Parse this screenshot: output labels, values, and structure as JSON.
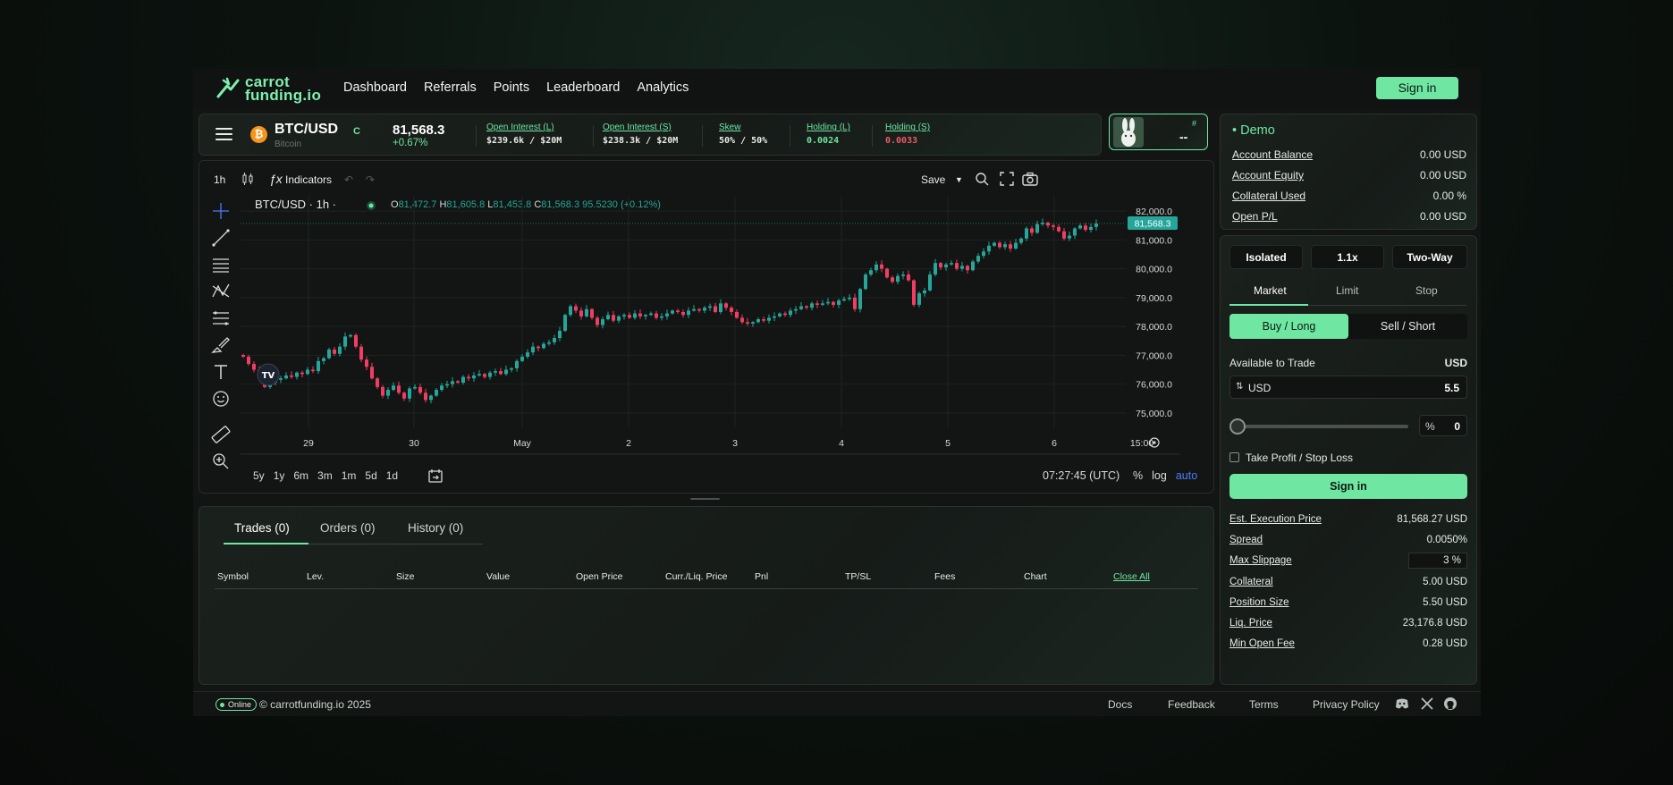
{
  "brand": {
    "line1": "carrot",
    "line2": "funding.io"
  },
  "nav": {
    "items": [
      "Dashboard",
      "Referrals",
      "Points",
      "Leaderboard",
      "Analytics"
    ],
    "signin": "Sign in"
  },
  "ticker": {
    "coin_symbol": "₿",
    "pair": "BTC/USD",
    "badge": "C",
    "name": "Bitcoin",
    "price": "81,568.3",
    "change": "+0.67%",
    "stats": [
      {
        "label": "Open Interest (L)",
        "value": "$239.6k / $20M"
      },
      {
        "label": "Open Interest (S)",
        "value": "$238.3k / $20M"
      },
      {
        "label": "Skew",
        "value": "50% / 50%"
      },
      {
        "label": "Holding (L)",
        "value": "0.0024"
      },
      {
        "label": "Holding (S)",
        "value": "0.0033"
      }
    ]
  },
  "avatar": {
    "hash": "#",
    "value": "--"
  },
  "chart_toolbar": {
    "interval": "1h",
    "indicators": "Indicators",
    "save": "Save"
  },
  "chart_header": {
    "title": "BTC/USD · 1h ·",
    "o_label": "O",
    "o": "81,472.7",
    "h_label": "H",
    "h": "81,605.8",
    "l_label": "L",
    "l": "81,453.8",
    "c_label": "C",
    "c": "81,568.3",
    "chg": "95.5230 (+0.12%)"
  },
  "chart_data": {
    "type": "candlestick",
    "title": "BTC/USD · 1h",
    "x_ticks": [
      "29",
      "30",
      "May",
      "2",
      "3",
      "4",
      "5",
      "6",
      "15:00"
    ],
    "y_ticks": [
      "82,000.0",
      "81,000.0",
      "80,000.0",
      "79,000.0",
      "78,000.0",
      "77,000.0",
      "76,000.0",
      "75,000.0"
    ],
    "ylim": [
      74500,
      82500
    ],
    "last_price_label": "81,568.3",
    "closes": [
      76950,
      76700,
      76500,
      76300,
      75900,
      76050,
      76150,
      76200,
      76300,
      76250,
      76400,
      76350,
      76500,
      76450,
      76800,
      76900,
      77200,
      77050,
      77300,
      77650,
      77700,
      77300,
      76850,
      76600,
      76200,
      75900,
      75600,
      75800,
      75950,
      75700,
      75500,
      75850,
      75900,
      75700,
      75450,
      75600,
      75800,
      75950,
      76000,
      76100,
      76050,
      76250,
      76200,
      76300,
      76350,
      76250,
      76400,
      76450,
      76350,
      76500,
      76550,
      76800,
      76950,
      77100,
      77300,
      77250,
      77400,
      77450,
      77600,
      77850,
      78400,
      78700,
      78550,
      78350,
      78600,
      78300,
      78050,
      78250,
      78400,
      78200,
      78350,
      78400,
      78300,
      78450,
      78350,
      78400,
      78450,
      78300,
      78350,
      78450,
      78550,
      78500,
      78400,
      78550,
      78600,
      78550,
      78650,
      78700,
      78500,
      78800,
      78650,
      78500,
      78300,
      78150,
      78100,
      78150,
      78250,
      78200,
      78300,
      78350,
      78450,
      78400,
      78550,
      78600,
      78700,
      78650,
      78800,
      78750,
      78800,
      78850,
      78750,
      78900,
      78950,
      79000,
      78600,
      79300,
      79800,
      79950,
      80150,
      80000,
      79700,
      79550,
      79750,
      79800,
      79600,
      78750,
      79150,
      79250,
      79800,
      80200,
      80050,
      80150,
      80200,
      80000,
      80100,
      79950,
      80250,
      80450,
      80600,
      80800,
      80900,
      80750,
      80850,
      80700,
      80900,
      81050,
      81400,
      81250,
      81550,
      81600,
      81500,
      81450,
      81300,
      81050,
      81150,
      81400,
      81500,
      81350,
      81450,
      81568
    ]
  },
  "time_buttons": [
    "5y",
    "1y",
    "6m",
    "3m",
    "1m",
    "5d",
    "1d"
  ],
  "clock": "07:27:45 (UTC)",
  "scale_buttons": [
    "%",
    "log",
    "auto"
  ],
  "trades": {
    "tabs": [
      "Trades (0)",
      "Orders (0)",
      "History (0)"
    ],
    "columns": [
      "Symbol",
      "Lev.",
      "Size",
      "Value",
      "Open Price",
      "Curr./Liq. Price",
      "Pnl",
      "TP/SL",
      "Fees",
      "Chart"
    ],
    "close_all": "Close All"
  },
  "footer": {
    "status": "Online",
    "copyright": "© carrotfunding.io 2025",
    "links": [
      "Docs",
      "Feedback",
      "Terms",
      "Privacy Policy"
    ]
  },
  "demo": {
    "title": "Demo",
    "rows": [
      {
        "k": "Account Balance",
        "v": "0.00 USD"
      },
      {
        "k": "Account Equity",
        "v": "0.00 USD"
      },
      {
        "k": "Collateral Used",
        "v": "0.00 %"
      },
      {
        "k": "Open P/L",
        "v": "0.00 USD"
      }
    ]
  },
  "order": {
    "margin_mode": "Isolated",
    "leverage": "1.1x",
    "position_mode": "Two-Way",
    "order_tabs": [
      "Market",
      "Limit",
      "Stop"
    ],
    "buy": "Buy / Long",
    "sell": "Sell / Short",
    "available_label": "Available to Trade",
    "available_unit": "USD",
    "input_unit": "USD",
    "input_value": "5.5",
    "slider_percent": 0,
    "pct_symbol": "%",
    "pct_value": "0",
    "tpsl": "Take Profit / Stop Loss",
    "signin": "Sign in",
    "details": [
      {
        "k": "Est. Execution Price",
        "v": "81,568.27 USD"
      },
      {
        "k": "Spread",
        "v": "0.0050%"
      },
      {
        "k": "Max Slippage",
        "v": "3 %"
      },
      {
        "k": "Collateral",
        "v": "5.00 USD"
      },
      {
        "k": "Position Size",
        "v": "5.50 USD"
      },
      {
        "k": "Liq. Price",
        "v": "23,176.8 USD"
      },
      {
        "k": "Min Open Fee",
        "v": "0.28 USD"
      }
    ]
  },
  "colors": {
    "accent": "#6fe7a2",
    "up": "#26a69a",
    "down": "#f23d63",
    "bg": "#121513"
  }
}
